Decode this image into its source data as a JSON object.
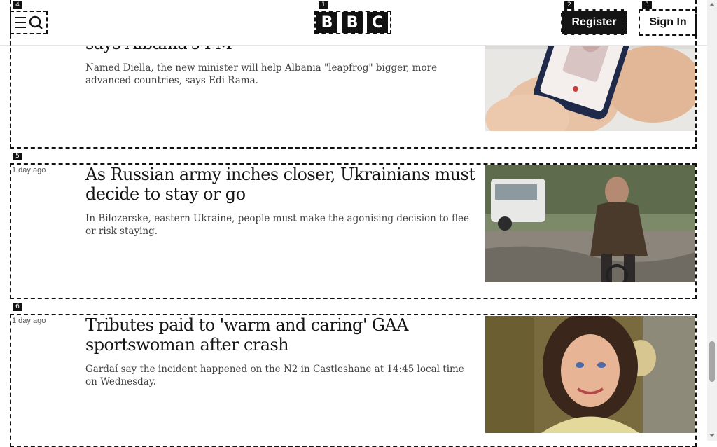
{
  "header": {
    "logo_letters": [
      "B",
      "B",
      "C"
    ],
    "register_label": "Register",
    "signin_label": "Sign In"
  },
  "overlay_tags": {
    "logo": "1",
    "register": "2",
    "signin": "3",
    "menu": "4",
    "article_2": "5",
    "article_3": "6"
  },
  "articles": [
    {
      "headline": "Albania's new AI minister will tackle corruption, says Albania's PM",
      "summary": "Named Diella, the new minister will help Albania \"leapfrog\" bigger, more advanced countries, says Edi Rama."
    },
    {
      "time": "1 day ago",
      "headline": "As Russian army inches closer, Ukrainians must decide to stay or go",
      "summary": "In Bilozerske, eastern Ukraine, people must make the agonising decision to flee or risk staying."
    },
    {
      "time": "1 day ago",
      "headline": "Tributes paid to 'warm and caring' GAA sportswoman after crash",
      "summary": "Gardaí say the incident happened on the N2 in Castleshane at 14:45 local time on Wednesday."
    }
  ],
  "colors": {
    "brand_black": "#141414",
    "background": "#ffffff"
  },
  "icons": {
    "menu": "menu-icon",
    "search": "search-icon"
  }
}
